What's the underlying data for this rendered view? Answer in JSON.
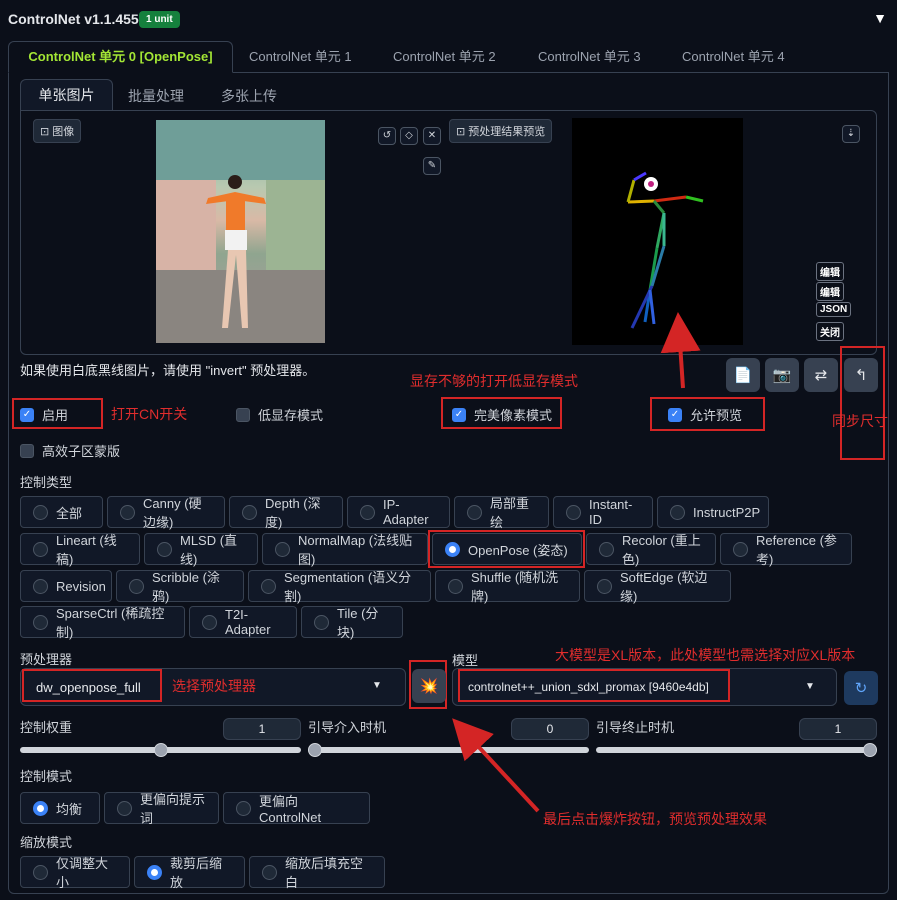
{
  "header": {
    "title": "ControlNet v1.1.455",
    "badge": "1 unit",
    "collapse": "▼"
  },
  "unit_tabs": [
    "ControlNet 单元 0 [OpenPose]",
    "ControlNet 单元 1",
    "ControlNet 单元 2",
    "ControlNet 单元 3",
    "ControlNet 单元 4"
  ],
  "input_tabs": [
    "单张图片",
    "批量处理",
    "多张上传"
  ],
  "image_label": "图像",
  "preview_label": "预处理结果预览",
  "side_buttons": [
    "编辑",
    "编辑",
    "JSON",
    "关闭"
  ],
  "hint": "如果使用白底黑线图片，请使用 \"invert\" 预处理器。",
  "annotations": {
    "lowvram": "显存不够的打开低显存模式",
    "enable": "打开CN开关",
    "sync": "同步尺寸",
    "preprocessor": "选择预处理器",
    "model": "大模型是XL版本，此处模型也需选择对应XL版本",
    "explode": "最后点击爆炸按钮，预览预处理效果"
  },
  "checkboxes": {
    "enable": "启用",
    "lowvram": "低显存模式",
    "pixel_perfect": "完美像素模式",
    "allow_preview": "允许预览",
    "mask_upload": "高效子区蒙版"
  },
  "control_type": {
    "label": "控制类型",
    "options": [
      "全部",
      "Canny (硬边缘)",
      "Depth (深度)",
      "IP-Adapter",
      "局部重绘",
      "Instant-ID",
      "InstructP2P",
      "Lineart (线稿)",
      "MLSD (直线)",
      "NormalMap (法线贴图)",
      "OpenPose (姿态)",
      "Recolor (重上色)",
      "Reference (参考)",
      "Revision",
      "Scribble (涂鸦)",
      "Segmentation (语义分割)",
      "Shuffle (随机洗牌)",
      "SoftEdge (软边缘)",
      "SparseCtrl (稀疏控制)",
      "T2I-Adapter",
      "Tile (分块)"
    ],
    "selected": "OpenPose (姿态)"
  },
  "preprocessor": {
    "label": "预处理器",
    "value": "dw_openpose_full"
  },
  "model": {
    "label": "模型",
    "value": "controlnet++_union_sdxl_promax [9460e4db]"
  },
  "sliders": {
    "weight_label": "控制权重",
    "weight": "1",
    "start_label": "引导介入时机",
    "start": "0",
    "end_label": "引导终止时机",
    "end": "1"
  },
  "weight_value": 1,
  "start_value": 0,
  "end_value": 1,
  "control_mode": {
    "label": "控制模式",
    "options": [
      "均衡",
      "更偏向提示词",
      "更偏向 ControlNet"
    ],
    "selected": "均衡"
  },
  "resize_mode": {
    "label": "缩放模式",
    "options": [
      "仅调整大小",
      "裁剪后缩放",
      "缩放后填充空白"
    ],
    "selected": "裁剪后缩放"
  }
}
